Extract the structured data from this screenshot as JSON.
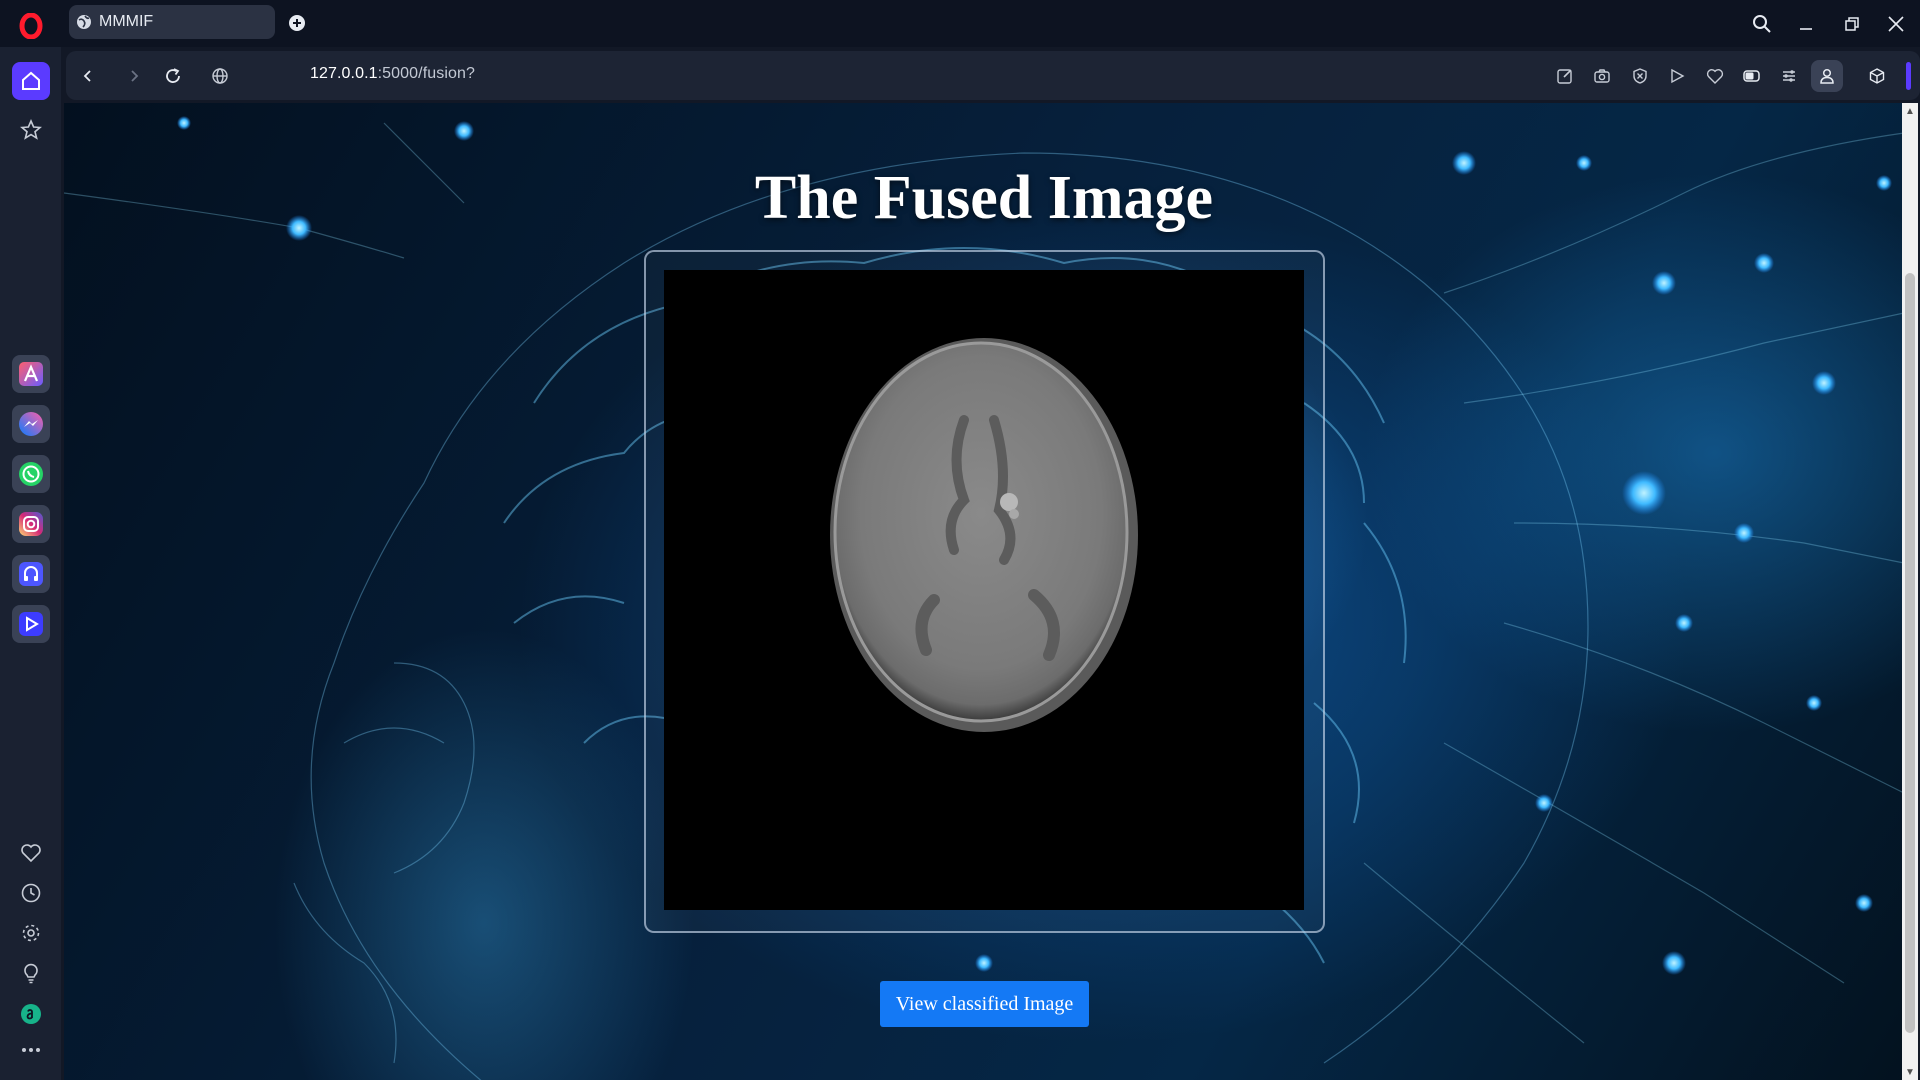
{
  "browser": {
    "tab_title": "MMMIF",
    "url_host": "127.0.0.1",
    "url_rest": ":5000/fusion?"
  },
  "page": {
    "title": "The Fused Image",
    "button_label": "View classified Image"
  },
  "colors": {
    "accent": "#1479f5",
    "sidebar_active": "#5b3bff",
    "background_glow": "#2fa8ff"
  },
  "icons": {
    "sidebar_top": [
      "opera-logo",
      "home-icon",
      "bookmark-star-icon"
    ],
    "sidebar_apps": [
      "aria-icon",
      "messenger-icon",
      "whatsapp-icon",
      "instagram-icon",
      "music-player-icon",
      "video-player-icon"
    ],
    "sidebar_bottom": [
      "heart-icon",
      "history-icon",
      "settings-icon",
      "tips-icon",
      "amazon-icon",
      "more-icon"
    ],
    "toolbar_right": [
      "edit-icon",
      "camera-icon",
      "adblock-icon",
      "play-icon",
      "heart-icon",
      "battery-icon",
      "easy-setup-icon",
      "profile-icon",
      "extensions-icon"
    ]
  }
}
